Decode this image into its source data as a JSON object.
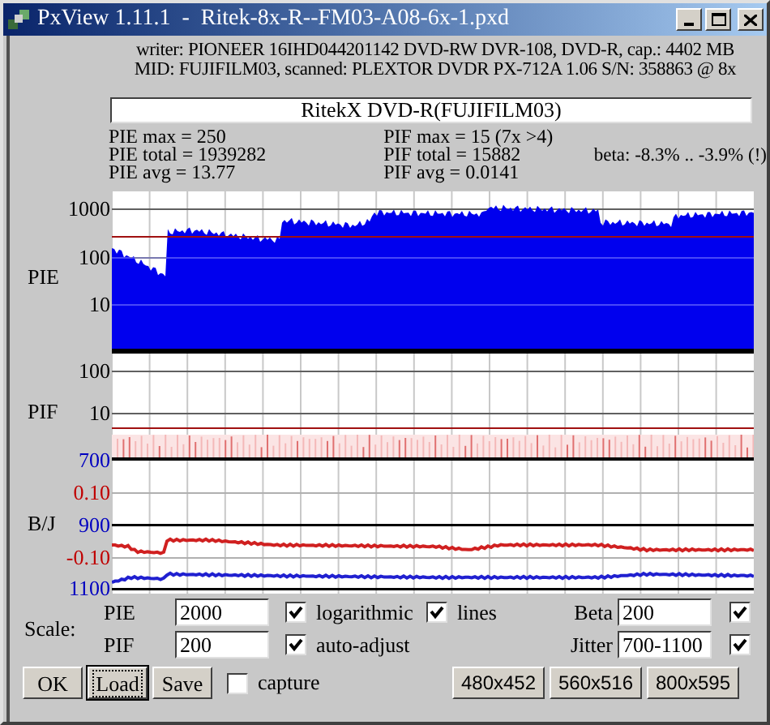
{
  "window": {
    "title": "PxView 1.11.1  -  Ritek-8x-R--FM03-A08-6x-1.pxd"
  },
  "info_lines": [
    "writer: PIONEER 16IHD044201142 DVD-RW DVR-108, DVD-R, cap.: 4402 MB",
    "MID: FUJIFILM03, scanned: PLEXTOR DVDR PX-712A 1.06 S/N: 358863 @ 8x"
  ],
  "disc_label": "RitekX DVD-R(FUJIFILM03)",
  "stats": {
    "pie": [
      "PIE max = 250",
      "PIE total = 1939282",
      "PIE avg = 13.77"
    ],
    "pif": [
      "PIF max = 15 (7x >4)",
      "PIF total = 15882",
      "PIF avg = 0.0141"
    ],
    "beta": "beta: -8.3% .. -3.9% (!)"
  },
  "panels": [
    {
      "label": "PIE",
      "ticks": [
        {
          "text": "1000",
          "color": "#000000"
        },
        {
          "text": "100",
          "color": "#000000"
        },
        {
          "text": "10",
          "color": "#000000"
        }
      ]
    },
    {
      "label": "PIF",
      "ticks": [
        {
          "text": "100",
          "color": "#000000"
        },
        {
          "text": "10",
          "color": "#000000"
        }
      ]
    },
    {
      "label": "B/J",
      "ticks": [
        {
          "text": "700",
          "color": "#0000c0"
        },
        {
          "text": "0.10",
          "color": "#c00000"
        },
        {
          "text": "900",
          "color": "#0000c0"
        },
        {
          "text": "-0.10",
          "color": "#c00000"
        },
        {
          "text": "1100",
          "color": "#0000c0"
        }
      ]
    }
  ],
  "scale": {
    "label": "Scale:",
    "rows": [
      {
        "field_label": "PIE",
        "value": "2000",
        "options": [
          {
            "label": "logarithmic",
            "checked": true
          },
          {
            "label": "lines",
            "checked": true
          }
        ],
        "right_label": "Beta",
        "right_value": "200",
        "right_checked": true
      },
      {
        "field_label": "PIF",
        "value": "200",
        "options": [
          {
            "label": "auto-adjust",
            "checked": true
          }
        ],
        "right_label": "Jitter",
        "right_value": "700-1100",
        "right_checked": true
      }
    ]
  },
  "buttons": [
    {
      "label": "OK",
      "focused": false
    },
    {
      "label": "Load",
      "focused": true
    },
    {
      "label": "Save",
      "focused": false
    }
  ],
  "capture": {
    "label": "capture",
    "checked": false
  },
  "size_buttons": [
    "480x452",
    "560x516",
    "800x595"
  ]
}
